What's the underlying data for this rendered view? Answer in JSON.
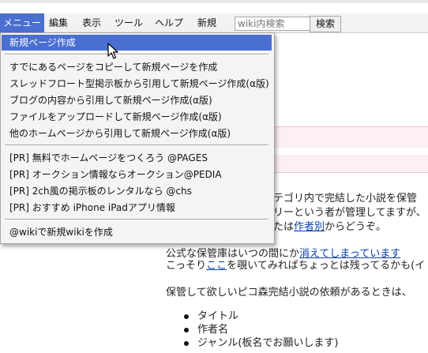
{
  "menubar": {
    "items": [
      "メニュー",
      "編集",
      "表示",
      "ツール",
      "ヘルプ",
      "新規"
    ],
    "search_placeholder": "wiki内検索",
    "search_button": "検索"
  },
  "dropdown": {
    "items": [
      "新規ページ作成",
      "すでにあるページをコピーして新規ページを作成",
      "スレッドフロート型掲示板から引用して新規ページ作成(α版)",
      "ブログの内容から引用して新規ページ作成(α版)",
      "ファイルをアップロードして新規ページ作成(α版)",
      "他のホームページから引用して新規ページ作成(α版)",
      "[PR] 無料でホームページをつくろう @PAGES",
      "[PR] オークション情報ならオークション@PEDIA",
      "[PR] 2ch風の掲示板のレンタルなら @chs",
      "[PR] おすすめ iPhone iPadアプリ情報",
      "@wikiで新規wikiを作成"
    ]
  },
  "page": {
    "line1": "テゴリ内で完結した小説を保管",
    "line2": "リーという者が管理してますが、",
    "line3_prefix": "たは",
    "line3_link": "作者別",
    "line3_suffix": "からどうぞ。",
    "line4_prefix": "公式な保管庫はいつの間にか",
    "line4_link": "消えてしまっています",
    "line5_prefix": "こっそり",
    "line5_link": "ここ",
    "line5_suffix": "を覗いてみればちょっとは残ってるかも(イ",
    "line6": "保管して欲しいピコ森完結小説の依頼があるときは、",
    "bullets": [
      "タイトル",
      "作者名",
      "ジャンル(板名でお願いします)"
    ]
  }
}
